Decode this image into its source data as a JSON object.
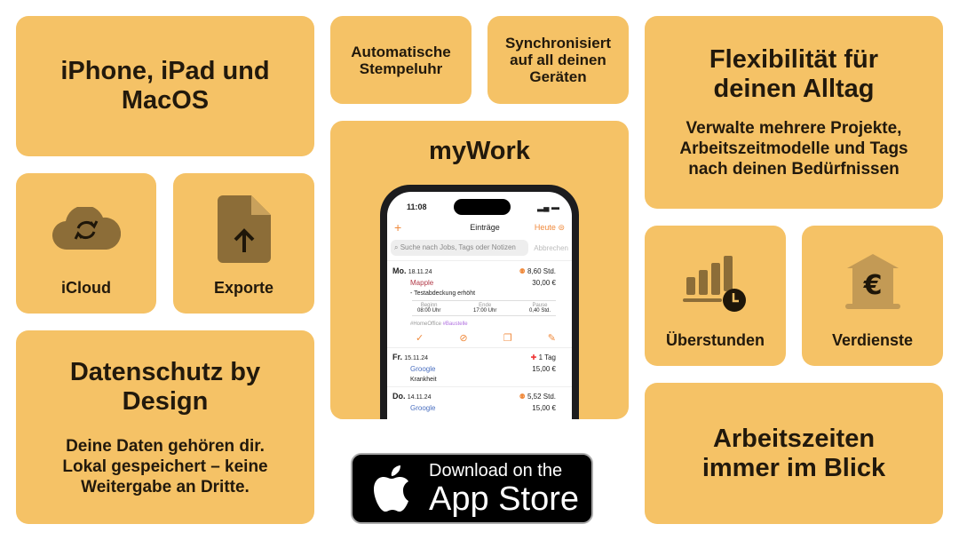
{
  "cards": {
    "platforms": "iPhone, iPad und MacOS",
    "clock": "Automatische Stempeluhr",
    "sync": "Synchronisiert auf all deinen Geräten",
    "flex_title": "Flexibilität für deinen Alltag",
    "flex_sub": "Verwalte mehrere Projekte, Arbeitszeitmodelle und Tags nach deinen Bedürfnissen",
    "icloud": "iCloud",
    "export": "Exporte",
    "app_name": "myWork",
    "overtime": "Überstunden",
    "earnings": "Verdienste",
    "privacy_title": "Datenschutz by Design",
    "privacy_sub": "Deine Daten gehören dir. Lokal gespeichert – keine Weitergabe an Dritte.",
    "hours": "Arbeitszeiten immer im Blick"
  },
  "colors": {
    "card": "#F5C266",
    "accent": "#f08a3c"
  },
  "phone": {
    "time": "11:08",
    "title": "Einträge",
    "today": "Heute",
    "search_placeholder": "Suche nach Jobs, Tags oder Notizen",
    "cancel": "Abbrechen",
    "entries": [
      {
        "day": "Mo.",
        "date": "18.11.24",
        "duration": "8,60 Std.",
        "project": "Mapple",
        "amount": "30,00 €",
        "note": "- Testabdeckung erhöht",
        "details": {
          "start_label": "Beginn",
          "start": "08:00 Uhr",
          "end_label": "Ende",
          "end": "17:00 Uhr",
          "pause_label": "Pause",
          "pause": "0,40 Std."
        },
        "tags": [
          "#HomeOffice",
          "#Baustelle"
        ]
      },
      {
        "day": "Fr.",
        "date": "15.11.24",
        "duration": "1 Tag",
        "project": "Groogle",
        "amount": "15,00 €",
        "note": "Krankheit"
      },
      {
        "day": "Do.",
        "date": "14.11.24",
        "duration": "5,52 Std.",
        "project": "Groogle",
        "amount": "15,00 €"
      }
    ]
  },
  "badge": {
    "line1": "Download on the",
    "line2": "App Store"
  }
}
